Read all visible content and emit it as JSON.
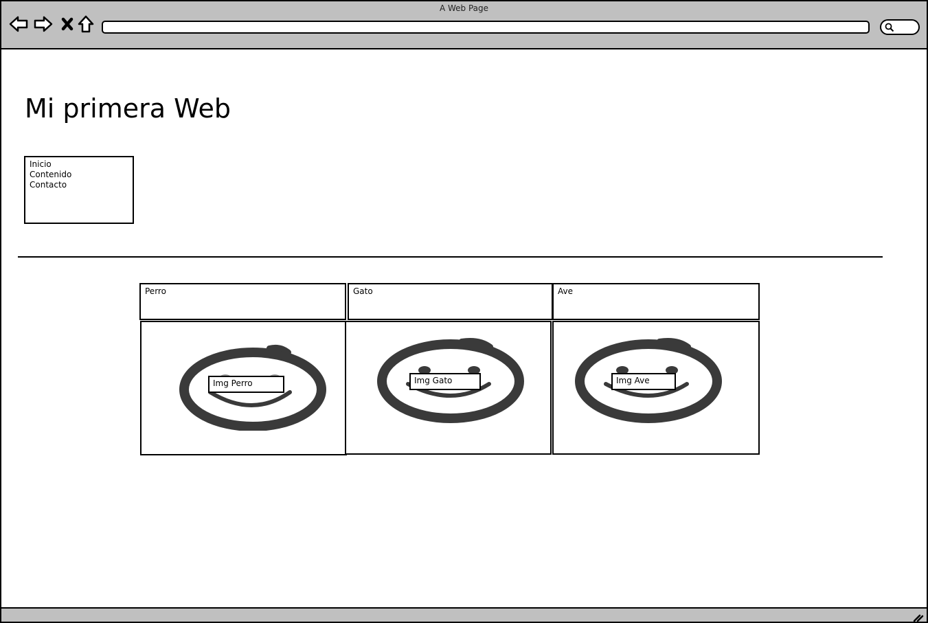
{
  "window": {
    "title": "A Web Page"
  },
  "toolbar": {
    "back_icon": "back-arrow-icon",
    "forward_icon": "forward-arrow-icon",
    "stop_icon": "close-icon",
    "home_icon": "home-icon",
    "address_value": "",
    "search_icon": "search-icon"
  },
  "page": {
    "title": "Mi primera Web",
    "nav": {
      "items": [
        {
          "label": "Inicio"
        },
        {
          "label": "Contenido"
        },
        {
          "label": "Contacto"
        }
      ]
    },
    "columns": [
      {
        "header": "Perro",
        "image_label": "Img Perro"
      },
      {
        "header": "Gato",
        "image_label": "Img Gato"
      },
      {
        "header": "Ave",
        "image_label": "Img Ave"
      }
    ]
  },
  "colors": {
    "chrome": "#c0c0c0",
    "stroke": "#000000",
    "placeholder_stroke": "#3a3a3a"
  }
}
